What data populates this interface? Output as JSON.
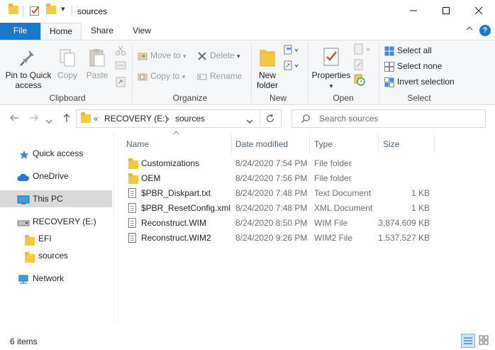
{
  "titlebar": {
    "title": "sources",
    "minimize": "–",
    "maximize": "☐",
    "close": "✕"
  },
  "ribbon_tabs": {
    "file": "File",
    "home": "Home",
    "share": "Share",
    "view": "View",
    "collapse": "⌃",
    "help": "?"
  },
  "clipboard": {
    "pin_line1": "Pin to Quick",
    "pin_line2": "access",
    "copy": "Copy",
    "paste": "Paste",
    "group": "Clipboard"
  },
  "organize": {
    "move_to": "Move to",
    "copy_to": "Copy to",
    "delete": "Delete",
    "rename": "Rename",
    "group": "Organize"
  },
  "new_group": {
    "new_folder_line1": "New",
    "new_folder_line2": "folder",
    "group": "New"
  },
  "open_group": {
    "properties": "Properties",
    "group": "Open"
  },
  "select_group": {
    "select_all": "Select all",
    "select_none": "Select none",
    "invert": "Invert selection",
    "group": "Select"
  },
  "address": {
    "chevrons": "«",
    "drive": "RECOVERY (E:)",
    "separator": "›",
    "folder": "sources"
  },
  "search": {
    "placeholder": "Search sources"
  },
  "navpane": {
    "items": [
      {
        "label": "Quick access",
        "icon": "star-icon"
      },
      {
        "label": "OneDrive",
        "icon": "cloud-icon"
      },
      {
        "label": "This PC",
        "icon": "computer-icon"
      },
      {
        "label": "RECOVERY (E:)",
        "icon": "drive-icon"
      },
      {
        "label": "EFI",
        "icon": "folder-icon"
      },
      {
        "label": "sources",
        "icon": "folder-icon"
      },
      {
        "label": "Network",
        "icon": "network-icon"
      }
    ]
  },
  "columns": {
    "name": "Name",
    "date": "Date modified",
    "type": "Type",
    "size": "Size"
  },
  "files": [
    {
      "name": "Customizations",
      "date": "8/24/2020 7:54 PM",
      "type": "File folder",
      "size": "",
      "icon": "folder-icon"
    },
    {
      "name": "OEM",
      "date": "8/24/2020 7:56 PM",
      "type": "File folder",
      "size": "",
      "icon": "folder-icon"
    },
    {
      "name": "$PBR_Diskpart.txt",
      "date": "8/24/2020 7:48 PM",
      "type": "Text Document",
      "size": "1 KB",
      "icon": "text-file-icon"
    },
    {
      "name": "$PBR_ResetConfig.xml",
      "date": "8/24/2020 7:48 PM",
      "type": "XML Document",
      "size": "1 KB",
      "icon": "xml-file-icon"
    },
    {
      "name": "Reconstruct.WIM",
      "date": "8/24/2020 8:50 PM",
      "type": "WIM File",
      "size": "3,874,609 KB",
      "icon": "file-icon"
    },
    {
      "name": "Reconstruct.WIM2",
      "date": "8/24/2020 9:26 PM",
      "type": "WIM2 File",
      "size": "1,537,527 KB",
      "icon": "file-icon"
    }
  ],
  "status": {
    "item_count": "6 items"
  }
}
